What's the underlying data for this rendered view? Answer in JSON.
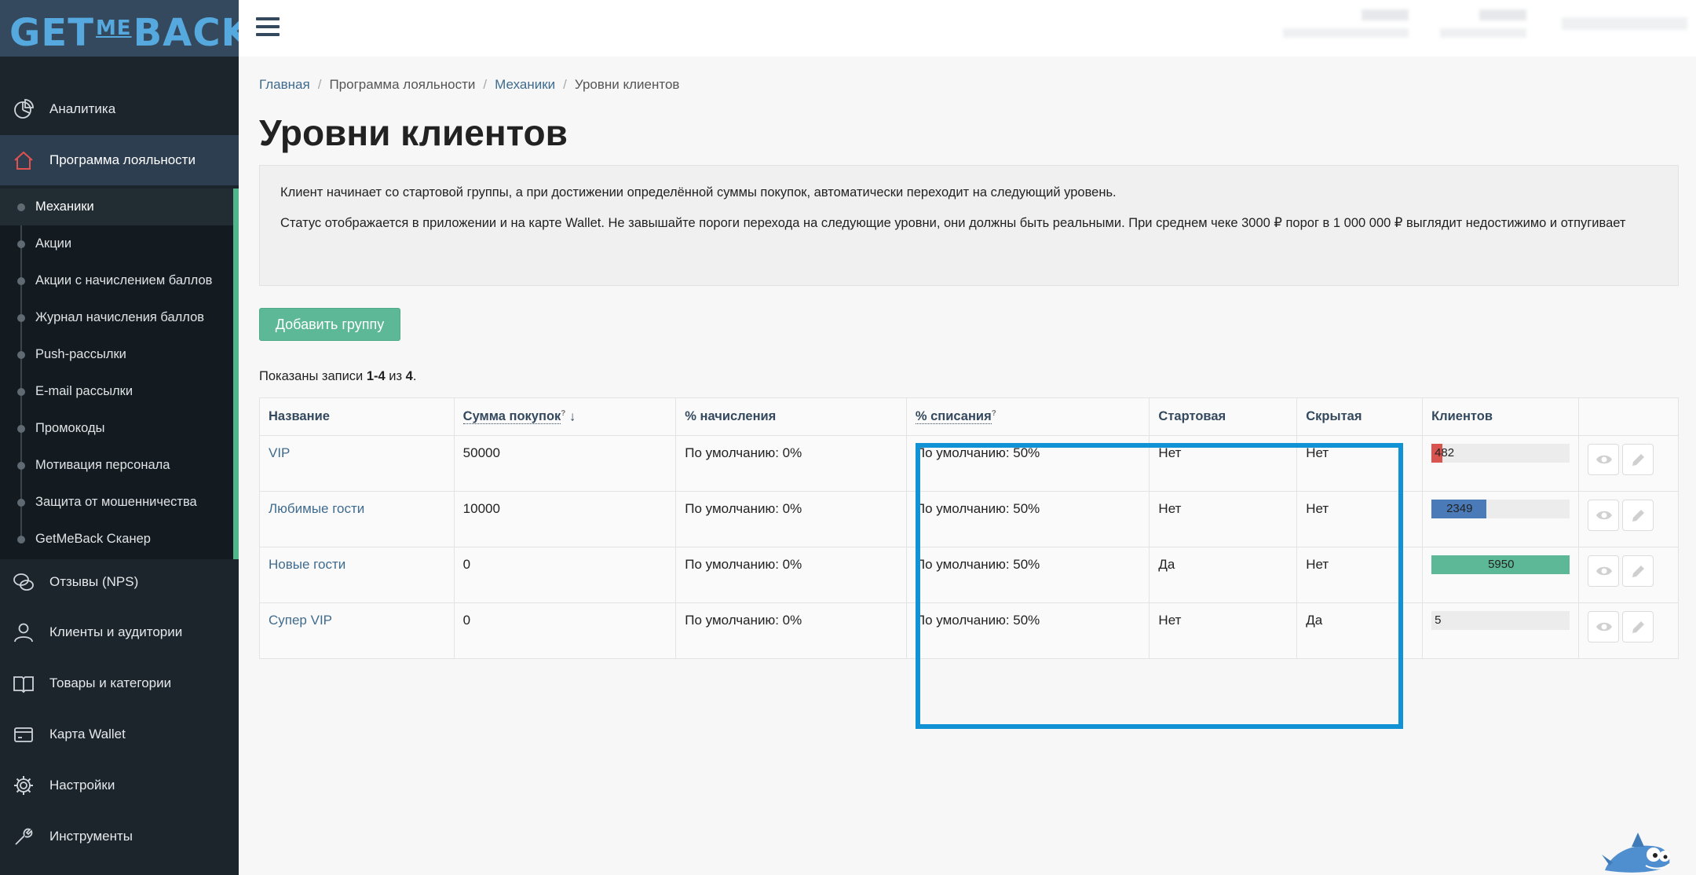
{
  "brand": {
    "logo_left": "GET",
    "logo_me": "ME",
    "logo_right": "BACK",
    "color": "#56a9de"
  },
  "sidebar": {
    "items": [
      {
        "label": "Аналитика",
        "icon": "pie-chart-icon"
      },
      {
        "label": "Программа лояльности",
        "icon": "home-icon",
        "active": true
      },
      {
        "label": "Отзывы (NPS)",
        "icon": "chat-icon"
      },
      {
        "label": "Клиенты и аудитории",
        "icon": "user-icon"
      },
      {
        "label": "Товары и категории",
        "icon": "book-icon"
      },
      {
        "label": "Карта Wallet",
        "icon": "card-icon"
      },
      {
        "label": "Настройки",
        "icon": "gear-icon"
      },
      {
        "label": "Инструменты",
        "icon": "wrench-icon"
      }
    ],
    "submenu": [
      {
        "label": "Механики",
        "active": true
      },
      {
        "label": "Акции"
      },
      {
        "label": "Акции с начислением баллов"
      },
      {
        "label": "Журнал начисления баллов"
      },
      {
        "label": "Push-рассылки"
      },
      {
        "label": "E-mail рассылки"
      },
      {
        "label": "Промокоды"
      },
      {
        "label": "Мотивация персонала"
      },
      {
        "label": "Защита от мошенничества"
      },
      {
        "label": "GetMeBack Сканер"
      }
    ],
    "accent": "#52b68d"
  },
  "breadcrumb": [
    {
      "label": "Главная",
      "link": true
    },
    {
      "label": "Программа лояльности",
      "link": false
    },
    {
      "label": "Механики",
      "link": true
    },
    {
      "label": "Уровни клиентов",
      "link": false
    }
  ],
  "page": {
    "title": "Уровни клиентов",
    "info_line1": "Клиент начинает со стартовой группы, а при достижении определённой суммы покупок, автоматически переходит на следующий уровень.",
    "info_line2": "Статус отображается в приложении и на карте Wallet. Не завышайте пороги перехода на следующие уровни, они должны быть реальными. При среднем чеке 3000 ₽ порог в 1 000 000 ₽ выглядит недостижимо и отпугивает",
    "add_button": "Добавить группу",
    "summary_prefix": "Показаны записи ",
    "summary_range": "1-4",
    "summary_mid": " из ",
    "summary_total": "4",
    "summary_suffix": "."
  },
  "table": {
    "headers": {
      "name": "Название",
      "sum": "Сумма покупок",
      "sum_hint": "?",
      "sort_arrow": "↓",
      "accrual": "% начисления",
      "writeoff": "% списания",
      "writeoff_hint": "?",
      "start": "Стартовая",
      "hidden": "Скрытая",
      "clients": "Клиентов"
    },
    "rows": [
      {
        "name": "VIP",
        "sum": "50000",
        "accrual": "По умолчанию: 0%",
        "writeoff": "По умолчанию: 50%",
        "start": "Нет",
        "hidden": "Нет",
        "clients": "482",
        "clients_fraction": 0.081,
        "bar_color": "#d9534f"
      },
      {
        "name": "Любимые гости",
        "sum": "10000",
        "accrual": "По умолчанию: 0%",
        "writeoff": "По умолчанию: 50%",
        "start": "Нет",
        "hidden": "Нет",
        "clients": "2349",
        "clients_fraction": 0.395,
        "bar_color": "#4a7ab8"
      },
      {
        "name": "Новые гости",
        "sum": "0",
        "accrual": "По умолчанию: 0%",
        "writeoff": "По умолчанию: 50%",
        "start": "Да",
        "hidden": "Нет",
        "clients": "5950",
        "clients_fraction": 1.0,
        "bar_color": "#5cb896"
      },
      {
        "name": "Супер VIP",
        "sum": "0",
        "accrual": "По умолчанию: 0%",
        "writeoff": "По умолчанию: 50%",
        "start": "Нет",
        "hidden": "Да",
        "clients": "5",
        "clients_fraction": 0.0,
        "bar_color": "#5cb896"
      }
    ]
  },
  "highlight_color": "#1092d4"
}
